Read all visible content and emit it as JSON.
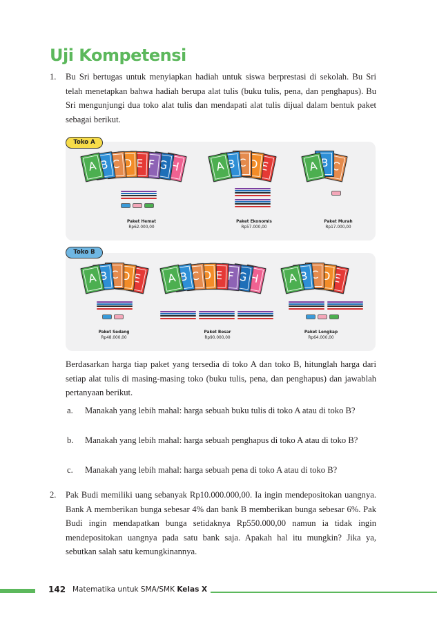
{
  "section_title": "Uji Kompetensi",
  "q1": {
    "number": "1.",
    "text": "Bu Sri bertugas untuk menyiapkan hadiah untuk siswa berprestasi di sekolah. Bu Sri telah menetapkan bahwa hadiah berupa alat tulis (buku tulis, pena, dan penghapus). Bu Sri mengunjungi dua toko alat tulis dan mendapati alat tulis dijual dalam bentuk paket sebagai berikut.",
    "store_a": {
      "label": "Toko A",
      "packages": [
        {
          "name": "Paket Hemat",
          "price": "Rp62.000,00",
          "books": [
            "A",
            "B",
            "C",
            "D",
            "E",
            "F",
            "G",
            "H"
          ],
          "pens": 4,
          "erasers": [
            "#3a9ad9",
            "#f4a7b9",
            "#4caf50"
          ]
        },
        {
          "name": "Paket Ekonomis",
          "price": "Rp57.000,00",
          "books": [
            "A",
            "B",
            "C",
            "D",
            "E"
          ],
          "pens": 8,
          "erasers": []
        },
        {
          "name": "Paket Murah",
          "price": "Rp17.000,00",
          "books": [
            "A",
            "B",
            "C"
          ],
          "pens": 0,
          "erasers": [
            "#f4a7b9"
          ]
        }
      ]
    },
    "store_b": {
      "label": "Toko B",
      "packages": [
        {
          "name": "Paket Sedang",
          "price": "Rp48.000,00",
          "books": [
            "A",
            "B",
            "C",
            "D",
            "E"
          ],
          "pens": 4,
          "erasers": [
            "#3a9ad9",
            "#f4a7b9"
          ]
        },
        {
          "name": "Paket Besar",
          "price": "Rp90.000,00",
          "books": [
            "A",
            "B",
            "C",
            "D",
            "E",
            "F",
            "G",
            "H"
          ],
          "pens": 12,
          "erasers": []
        },
        {
          "name": "Paket Lengkap",
          "price": "Rp64.000,00",
          "books": [
            "A",
            "B",
            "C",
            "D",
            "E"
          ],
          "pens": 8,
          "erasers": [
            "#3a9ad9",
            "#f4a7b9",
            "#4caf50"
          ]
        }
      ]
    },
    "paragraph": "Berdasarkan harga tiap paket yang tersedia di toko A dan toko B, hitunglah harga dari setiap alat tulis di masing-masing toko (buku tulis, pena, dan penghapus) dan jawablah pertanyaan berikut.",
    "subquestions": [
      {
        "label": "a.",
        "text": "Manakah yang lebih mahal: harga sebuah buku tulis di toko A atau di toko B?"
      },
      {
        "label": "b.",
        "text": "Manakah yang lebih mahal: harga sebuah penghapus di toko A atau di toko B?"
      },
      {
        "label": "c.",
        "text": "Manakah yang lebih mahal: harga sebuah pena di toko A atau di toko B?"
      }
    ]
  },
  "q2": {
    "number": "2.",
    "text": "Pak Budi memiliki uang sebanyak Rp10.000.000,00. Ia ingin mendepositokan uangnya. Bank A memberikan bunga sebesar 4% dan bank B memberikan bunga sebesar 6%. Pak Budi ingin mendapatkan bunga setidaknya Rp550.000,00 namun ia tidak ingin mendepositokan uangnya pada satu bank saja. Apakah hal itu mungkin? Jika ya, sebutkan salah satu kemungkinannya."
  },
  "footer": {
    "page_number": "142",
    "book_title": "Matematika untuk SMA/SMK ",
    "book_class": "Kelas X"
  },
  "colors": {
    "accent": "#5cb85c",
    "book_colors": [
      "#4caf50",
      "#2e8fd6",
      "#e58b4d",
      "#f28c28",
      "#e53935",
      "#8e63b5",
      "#1e6fb8",
      "#f06292"
    ],
    "store_a_tag": "#f7dc49",
    "store_b_tag": "#6fb7e3"
  }
}
